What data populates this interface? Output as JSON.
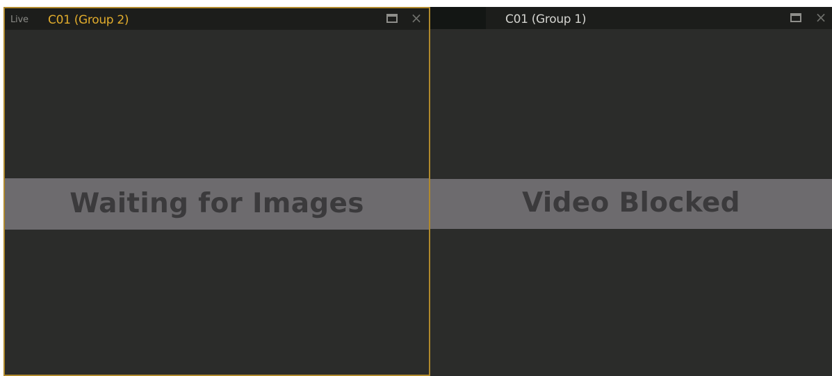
{
  "panes": [
    {
      "mode_label": "Live",
      "camera_title": "C01 (Group 2)",
      "status_message": "Waiting for Images",
      "selected": true,
      "maximize_icon": "maximize-icon",
      "close_icon": "close-icon"
    },
    {
      "mode_label": "",
      "camera_title": "C01 (Group 1)",
      "status_message": "Video Blocked",
      "selected": false,
      "maximize_icon": "maximize-icon",
      "close_icon": "close-icon"
    }
  ],
  "colors": {
    "selected_border": "#b0892c",
    "selected_title": "#e1ac2c",
    "pane_background": "#2b2c2a",
    "titlebar": "#1c1d1b",
    "status_band": "#6d6b6e",
    "status_text": "#3b3a3c"
  }
}
